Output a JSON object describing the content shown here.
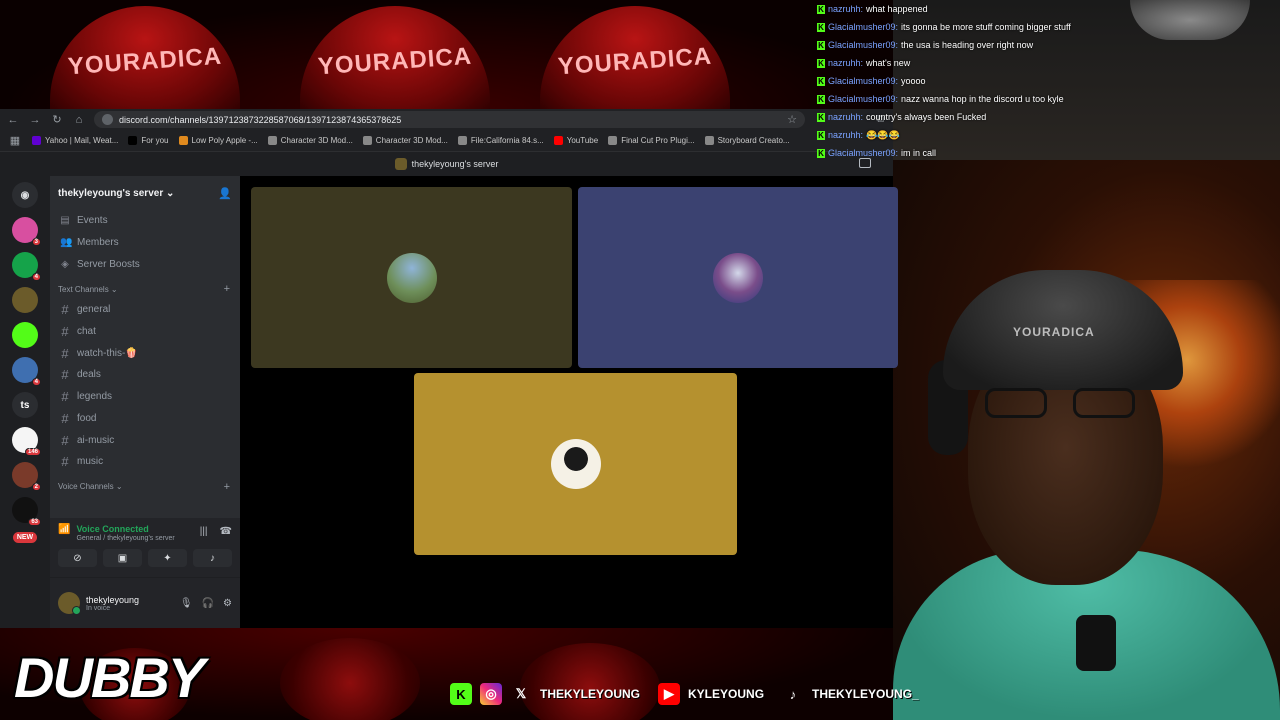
{
  "overlay": {
    "cap_text": "YOURADICA",
    "logo": "DUBBY",
    "socials": [
      {
        "icon": "kick-icon",
        "text": ""
      },
      {
        "icon": "instagram-icon",
        "text": ""
      },
      {
        "icon": "x-icon",
        "text": "THEKYLEYOUNG"
      },
      {
        "icon": "youtube-icon",
        "text": "KYLEYOUNG"
      },
      {
        "icon": "tiktok-icon",
        "text": "THEKYLEYOUNG_"
      }
    ],
    "hat_text": "YOURADICA"
  },
  "chat": [
    {
      "user": "nazruhh:",
      "text": "what happened"
    },
    {
      "user": "Glacialmusher09:",
      "text": "its gonna be more stuff coming bigger stuff"
    },
    {
      "user": "Glacialmusher09:",
      "text": "the usa is heading over right now"
    },
    {
      "user": "nazruhh:",
      "text": "what's new"
    },
    {
      "user": "Glacialmusher09:",
      "text": "yoooo"
    },
    {
      "user": "Glacialmusher09:",
      "text": "nazz wanna hop in the discord u too kyle"
    },
    {
      "user": "nazruhh:",
      "text": "country's always been Fucked"
    },
    {
      "user": "nazruhh:",
      "text": "😂😂😂"
    },
    {
      "user": "Glacialmusher09:",
      "text": "im in call"
    }
  ],
  "browser": {
    "url": "discord.com/channels/1397123873228587068/1397123874365378625",
    "bookmarks": [
      {
        "label": "Yahoo | Mail, Weat...",
        "color": "#6001d2"
      },
      {
        "label": "For you",
        "color": "#000000"
      },
      {
        "label": "Low Poly Apple -...",
        "color": "#e08a1e"
      },
      {
        "label": "Character 3D Mod...",
        "color": "#888888"
      },
      {
        "label": "Character 3D Mod...",
        "color": "#888888"
      },
      {
        "label": "File:California 84.s...",
        "color": "#888888"
      },
      {
        "label": "YouTube",
        "color": "#ff0000"
      },
      {
        "label": "Final Cut Pro Plugi...",
        "color": "#888888"
      },
      {
        "label": "Storyboard Creato...",
        "color": "#888888"
      }
    ]
  },
  "discord": {
    "window_title": "thekyleyoung's server",
    "server_name": "thekyleyoung's server",
    "guild_badges": [
      "3",
      "4",
      "",
      "",
      "4",
      "",
      "146",
      "2",
      "63"
    ],
    "guild_ts": "ts",
    "new_label": "NEW",
    "nav": [
      {
        "icon": "calendar-icon",
        "label": "Events"
      },
      {
        "icon": "members-icon",
        "label": "Members"
      },
      {
        "icon": "boost-icon",
        "label": "Server Boosts"
      }
    ],
    "text_category": "Text Channels",
    "text_channels": [
      "general",
      "chat",
      "watch-this-🍿",
      "deals",
      "legends",
      "food",
      "ai-music",
      "music"
    ],
    "voice_category": "Voice Channels",
    "voice": {
      "status": "Voice Connected",
      "location": "General / thekyleyoung's server"
    },
    "user": {
      "name": "thekyleyoung",
      "status": "In voice"
    },
    "tiles": [
      {
        "color": "#3c3820"
      },
      {
        "color": "#3b4271"
      },
      {
        "color": "#b5912f"
      }
    ]
  },
  "colors": {
    "discord_bg": "#1e1f22",
    "sidebar_bg": "#2b2d31",
    "voice_green": "#23a55a",
    "kick_green": "#53fc18"
  }
}
